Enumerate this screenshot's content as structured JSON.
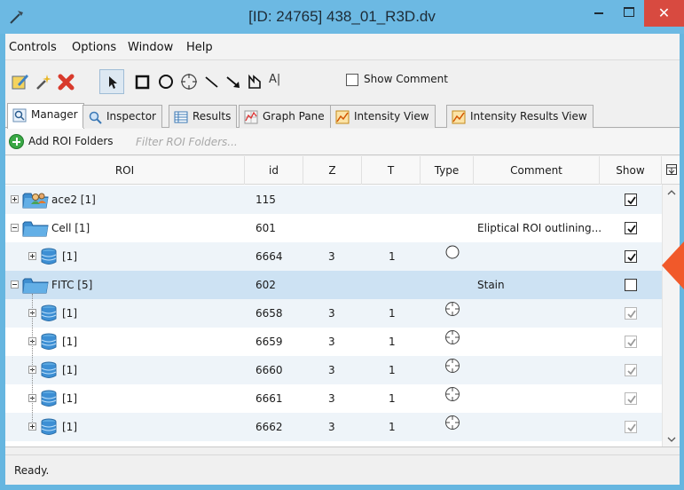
{
  "window": {
    "title": "[ID: 24765] 438_01_R3D.dv",
    "close_glyph": "✕"
  },
  "menu": [
    "Controls",
    "Options",
    "Window",
    "Help"
  ],
  "toolbar": {
    "tools": [
      "edit-icon",
      "magic-wand-icon",
      "delete-icon",
      "pointer-icon",
      "rectangle-icon",
      "ellipse-icon",
      "point-icon",
      "line-icon",
      "arrow-icon",
      "polygon-icon",
      "text-icon"
    ],
    "text_tool_label": "A|",
    "show_comment_label": "Show Comment",
    "show_comment_checked": false
  },
  "tabs": [
    {
      "label": "Manager",
      "active": true
    },
    {
      "label": "Inspector",
      "active": false
    },
    {
      "label": "Results",
      "active": false
    },
    {
      "label": "Graph Pane",
      "active": false
    },
    {
      "label": "Intensity View",
      "active": false
    },
    {
      "label": "Intensity Results View",
      "active": false
    }
  ],
  "folders": {
    "add_label": "Add ROI Folders",
    "filter_placeholder": "Filter ROI Folders..."
  },
  "table": {
    "columns": [
      "ROI",
      "id",
      "Z",
      "T",
      "Type",
      "Comment",
      "Show"
    ],
    "rows": [
      {
        "roi": "ace2 [1]",
        "id": "115",
        "z": "",
        "t": "",
        "type": "",
        "comment": "",
        "show": true,
        "kind": "group-folder"
      },
      {
        "roi": "Cell [1]",
        "id": "601",
        "z": "",
        "t": "",
        "type": "",
        "comment": "Eliptical ROI outlining...",
        "show": true,
        "kind": "folder"
      },
      {
        "roi": "[1]",
        "id": "6664",
        "z": "3",
        "t": "1",
        "type": "ellipse",
        "comment": "",
        "show": true,
        "kind": "roi"
      },
      {
        "roi": "FITC [5]",
        "id": "602",
        "z": "",
        "t": "",
        "type": "",
        "comment": "Stain",
        "show": false,
        "kind": "folder"
      },
      {
        "roi": "[1]",
        "id": "6658",
        "z": "3",
        "t": "1",
        "type": "point",
        "comment": "",
        "show": true,
        "kind": "roi"
      },
      {
        "roi": "[1]",
        "id": "6659",
        "z": "3",
        "t": "1",
        "type": "point",
        "comment": "",
        "show": true,
        "kind": "roi"
      },
      {
        "roi": "[1]",
        "id": "6660",
        "z": "3",
        "t": "1",
        "type": "point",
        "comment": "",
        "show": true,
        "kind": "roi"
      },
      {
        "roi": "[1]",
        "id": "6661",
        "z": "3",
        "t": "1",
        "type": "point",
        "comment": "",
        "show": true,
        "kind": "roi"
      },
      {
        "roi": "[1]",
        "id": "6662",
        "z": "3",
        "t": "1",
        "type": "point",
        "comment": "",
        "show": true,
        "kind": "roi"
      }
    ]
  },
  "status": "Ready.",
  "colors": {
    "title_bar": "#6cb9e3",
    "close_button": "#d84a40",
    "selected_row": "#cde2f3",
    "annotation_arrow": "#f1592a"
  }
}
